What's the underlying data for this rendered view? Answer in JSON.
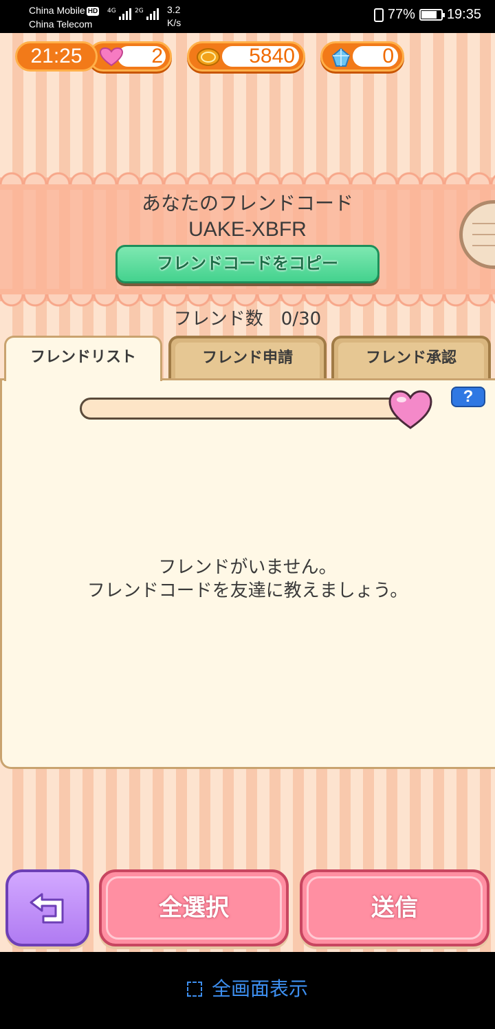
{
  "status_bar": {
    "carrier1": "China Mobile",
    "hd": "HD",
    "carrier2": "China Telecom",
    "net1": "4G",
    "net2": "2G",
    "speed_value": "3.2",
    "speed_unit": "K/s",
    "battery": "77%",
    "time": "19:35"
  },
  "hud": {
    "timer": "21:25",
    "hearts": "2",
    "coins": "5840",
    "gems": "0"
  },
  "friend_code": {
    "title": "あなたのフレンドコード",
    "code": "UAKE-XBFR",
    "copy_label": "フレンドコードをコピー"
  },
  "friend_count": "フレンド数　0/30",
  "tabs": [
    {
      "label": "フレンドリスト",
      "active": true
    },
    {
      "label": "フレンド申請",
      "active": false
    },
    {
      "label": "フレンド承認",
      "active": false
    }
  ],
  "help_label": "?",
  "empty_message": {
    "line1": "フレンドがいません。",
    "line2": "フレンドコードを友達に教えましょう。"
  },
  "buttons": {
    "select_all": "全選択",
    "send": "送信"
  },
  "fullscreen_label": "全画面表示",
  "colors": {
    "accent_orange": "#f27a19",
    "copy_green": "#44d28e",
    "pink_button": "#ff8fa2",
    "purple_button": "#b07bf2",
    "help_blue": "#2f78e3"
  }
}
